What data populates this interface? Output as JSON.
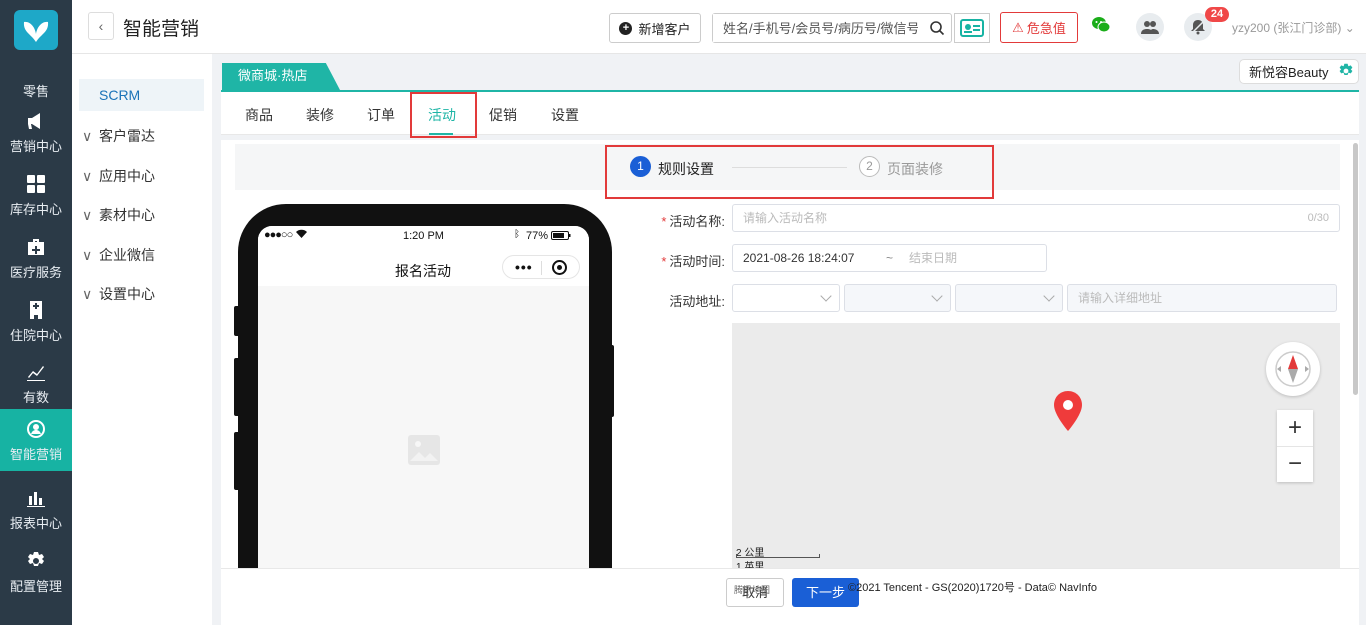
{
  "app": {
    "title": "智能营销"
  },
  "leftnav": {
    "items": [
      {
        "label": "零售",
        "icon": "retail-icon"
      },
      {
        "label": "营销中心",
        "icon": "megaphone-icon"
      },
      {
        "label": "库存中心",
        "icon": "grid-icon"
      },
      {
        "label": "医疗服务",
        "icon": "medical-kit-icon"
      },
      {
        "label": "住院中心",
        "icon": "hospital-icon"
      },
      {
        "label": "有数",
        "icon": "chart-line-icon"
      },
      {
        "label": "智能营销",
        "icon": "smart-marketing-icon",
        "active": true
      },
      {
        "label": "报表中心",
        "icon": "bar-chart-icon"
      },
      {
        "label": "配置管理",
        "icon": "gear-icon"
      }
    ]
  },
  "topbar": {
    "new_customer": "新增客户",
    "search_placeholder": "姓名/手机号/会员号/病历号/微信号",
    "critical_value": "危急值",
    "notification_count": "24",
    "user": "yzy200 (张江门诊部)"
  },
  "subnav": {
    "active": "SCRM",
    "items": [
      "客户雷达",
      "应用中心",
      "素材中心",
      "企业微信",
      "设置中心"
    ]
  },
  "store_tab": "微商城·热店",
  "brand": "新悦容Beauty",
  "tabs": [
    "商品",
    "装修",
    "订单",
    "活动",
    "促销",
    "设置"
  ],
  "steps": [
    {
      "num": "1",
      "label": "规则设置"
    },
    {
      "num": "2",
      "label": "页面装修"
    }
  ],
  "phone": {
    "time": "1:20 PM",
    "signal": "●●●○○",
    "battery": "77%",
    "page_title": "报名活动"
  },
  "form": {
    "name_label": "活动名称:",
    "name_placeholder": "请输入活动名称",
    "name_count": "0/30",
    "time_label": "活动时间:",
    "time_start": "2021-08-26 18:24:07",
    "time_sep": "~",
    "time_end_placeholder": "结束日期",
    "addr_label": "活动地址:",
    "addr_detail_placeholder": "请输入详细地址"
  },
  "map": {
    "scale_km": "2 公里",
    "scale_mi": "1 英里",
    "copyright": "©2021 Tencent - GS(2020)1720号 - Data© NavInfo",
    "logo_text": "腾讯地图"
  },
  "footer": {
    "cancel": "取消",
    "next": "下一步"
  },
  "colors": {
    "accent": "#1fb5a6",
    "primary": "#1a5fd6",
    "danger": "#e23a3a",
    "sidebar": "#2b3a47"
  }
}
